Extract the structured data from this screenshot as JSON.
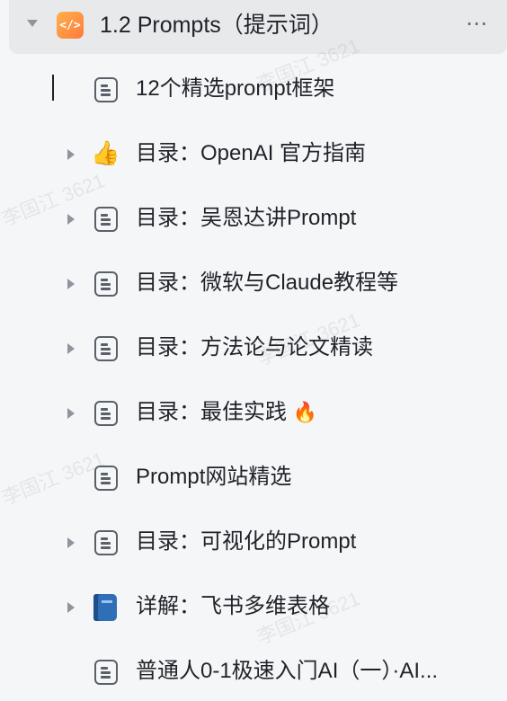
{
  "header": {
    "title": "1.2 Prompts（提示词）",
    "icon": "code-icon",
    "icon_glyph": "</>",
    "more_glyph": "⋯"
  },
  "watermark": "李国江 3621",
  "items": [
    {
      "label": "12个精选prompt框架",
      "icon": "doc-icon",
      "expandable": false
    },
    {
      "label": "目录：OpenAI 官方指南",
      "icon": "thumbs-up-icon",
      "emoji": "👍",
      "expandable": true
    },
    {
      "label": "目录：吴恩达讲Prompt",
      "icon": "doc-icon",
      "expandable": true
    },
    {
      "label": "目录：微软与Claude教程等",
      "icon": "doc-icon",
      "expandable": true
    },
    {
      "label": "目录：方法论与论文精读",
      "icon": "doc-icon",
      "expandable": true
    },
    {
      "label": "目录：最佳实践",
      "suffix_emoji": "🔥",
      "icon": "doc-icon",
      "expandable": true
    },
    {
      "label": "Prompt网站精选",
      "icon": "doc-icon",
      "expandable": false
    },
    {
      "label": "目录：可视化的Prompt",
      "icon": "doc-icon",
      "expandable": true
    },
    {
      "label": "详解：飞书多维表格",
      "icon": "book-icon",
      "expandable": true
    },
    {
      "label": "普通人0-1极速入门AI（一）·AI...",
      "icon": "doc-icon",
      "expandable": false
    }
  ],
  "colors": {
    "background": "#f5f6f7",
    "selected_row": "#e8e9eb",
    "text": "#1f2329",
    "icon": "#5a6069",
    "accent": "#ff7a3c"
  }
}
